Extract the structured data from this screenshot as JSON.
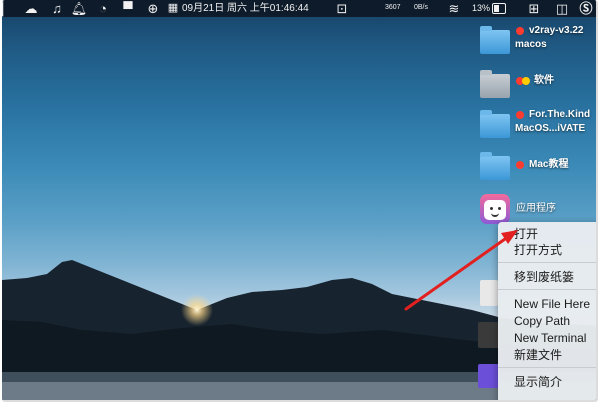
{
  "menubar": {
    "clock": "09月21日 周六 上午01:46:44",
    "net_count": "3607",
    "net_speed": "0B/s",
    "battery_percent": "13%",
    "icons": [
      "cloud-icon",
      "music-icon",
      "notification-icon",
      "dashboard-icon",
      "display-icon",
      "globe-icon",
      "calendar-icon",
      "screen-icon",
      "wifi-icon",
      "battery-icon",
      "input-method-icon",
      "split-view-icon",
      "s-app-icon"
    ]
  },
  "desktop": {
    "items": [
      {
        "label_line1": "v2ray-v3.22",
        "label_line2": "macos",
        "tag_color": "#ff3b30",
        "icon": "folder-icon"
      },
      {
        "label_line1": "软件",
        "label_line2": "",
        "tag_colors": [
          "#ff3b30",
          "#ffcc00"
        ],
        "icon": "folder-icon"
      },
      {
        "label_line1": "For.The.Kind",
        "label_line2": "MacOS...iVATE",
        "tag_color": "#ff3b30",
        "icon": "folder-icon"
      },
      {
        "label_line1": "Mac教程",
        "label_line2": "",
        "tag_color": "#ff3b30",
        "icon": "folder-icon"
      },
      {
        "label_line1": "应用程序",
        "label_line2": "",
        "icon": "app-icon"
      }
    ]
  },
  "context_menu": {
    "items": [
      "打开",
      "打开方式",
      "移到废纸篓",
      "New File Here",
      "Copy Path",
      "New Terminal",
      "新建文件",
      "显示简介"
    ]
  },
  "colors": {
    "arrow": "#e32020",
    "tag_red": "#ff3b30",
    "tag_yellow": "#ffcc00"
  }
}
